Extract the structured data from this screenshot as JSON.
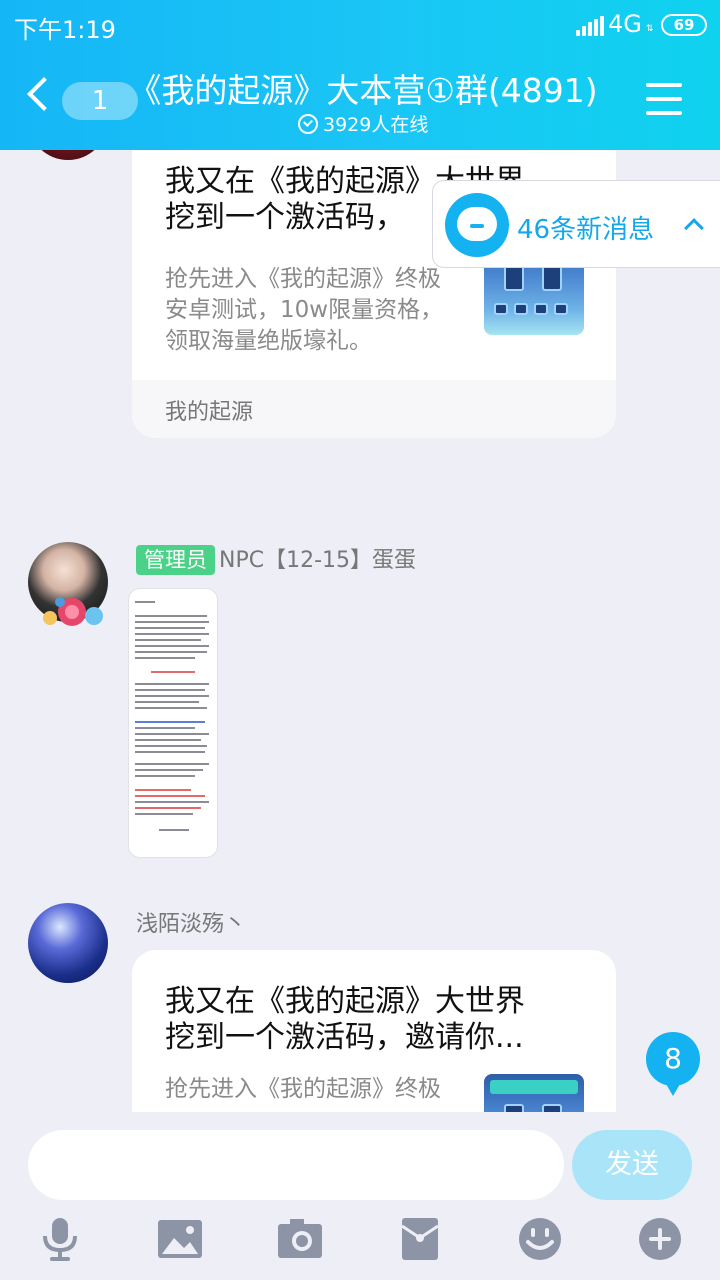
{
  "status_bar": {
    "time": "下午1:19",
    "network": "4G",
    "battery": "69"
  },
  "header": {
    "back_badge": "1",
    "title": "《我的起源》大本营①群(4891)",
    "online": "3929人在线"
  },
  "new_messages": {
    "label": "46条新消息"
  },
  "messages": [
    {
      "title": "我又在《我的起源》大世界挖到一个激活码，邀请你...",
      "title_visible": "我又在《我的起源》大世界\n挖到一个激活码，",
      "desc": "抢先进入《我的起源》终极安卓测试，10w限量资格，领取海量绝版壕礼。",
      "desc_lines": [
        "抢先进入《我的起源》终极",
        "安卓测试，10w限量资格，",
        "领取海量绝版壕礼。"
      ],
      "source": "我的起源"
    },
    {
      "role": "管理员",
      "sender": "NPC【12-15】蛋蛋"
    },
    {
      "sender": "浅陌淡殇丶",
      "title_lines": [
        "我又在《我的起源》大世界",
        "挖到一个激活码，邀请你..."
      ],
      "desc_lines": [
        "抢先进入《我的起源》终极"
      ]
    }
  ],
  "unread_count": "8",
  "composer": {
    "placeholder": "",
    "send_label": "发送"
  },
  "toolbar_icons": [
    "microphone-icon",
    "image-icon",
    "camera-icon",
    "red-packet-icon",
    "emoji-icon",
    "plus-icon"
  ],
  "colors": {
    "header_start": "#15b6f6",
    "header_end": "#0fd2ef",
    "accent": "#14b2f0",
    "admin_tag": "#4cd188",
    "send_disabled": "#a9e4f8"
  }
}
